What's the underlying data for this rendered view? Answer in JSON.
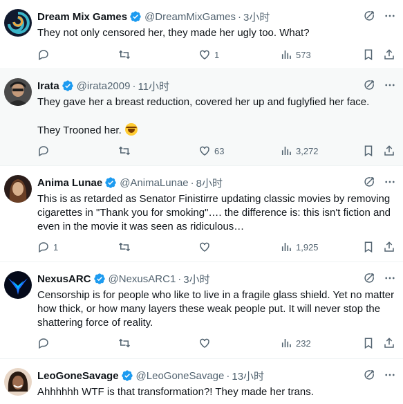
{
  "tweets": [
    {
      "name": "Dream Mix Games",
      "handle": "@DreamMixGames",
      "time": "3小时",
      "lines": [
        "They not only censored her, they made her ugly too. What?"
      ],
      "replies": "",
      "retweets": "",
      "likes": "1",
      "views": "573",
      "avatar_colors": [
        "#1a1a2e",
        "#3bb6c9",
        "#f2a53a"
      ]
    },
    {
      "name": "Irata",
      "handle": "@irata2009",
      "time": "11小时",
      "lines": [
        "They gave her a breast reduction, covered her up and fuglyfied her face.",
        "They Trooned her."
      ],
      "replies": "",
      "retweets": "",
      "likes": "63",
      "views": "3,272",
      "avatar_colors": [
        "#3a3a3a",
        "#c49a7a",
        "#1b1b1b"
      ]
    },
    {
      "name": "Anima Lunae",
      "handle": "@AnimaLunae",
      "time": "8小时",
      "lines": [
        "This is as retarded as Senator Finistirre updating classic movies by removing cigarettes in \"Thank you for smoking\"…. the difference is: this isn't fiction and even in the movie it was seen as ridiculous…"
      ],
      "replies": "1",
      "retweets": "",
      "likes": "",
      "views": "1,925",
      "avatar_colors": [
        "#2b1d1a",
        "#8a5a3c",
        "#d9b08c"
      ]
    },
    {
      "name": "NexusARC",
      "handle": "@NexusARC1",
      "time": "3小时",
      "lines": [
        "Censorship is for people who like to live in a fragile glass shield. Yet no matter how thick, or how many layers these weak people put. It will never stop the shattering force of reality."
      ],
      "replies": "",
      "retweets": "",
      "likes": "",
      "views": "232",
      "avatar_colors": [
        "#050a1a",
        "#1e6cff",
        "#00c2ff"
      ]
    },
    {
      "name": "LeoGoneSavage",
      "handle": "@LeoGoneSavage",
      "time": "13小时",
      "lines": [
        "Ahhhhhh WTF is that transformation?! They made her trans."
      ],
      "replies": "",
      "retweets": "",
      "likes": "",
      "views": "",
      "avatar_colors": [
        "#3b2a20",
        "#9c6b4e",
        "#e8d6c6"
      ]
    }
  ],
  "colors": {
    "text_primary": "#0f1419",
    "text_secondary": "#536471",
    "verified_blue": "#1d9bf0",
    "highlight_bg": "#f7f9f9",
    "divider": "#eff3f4"
  }
}
